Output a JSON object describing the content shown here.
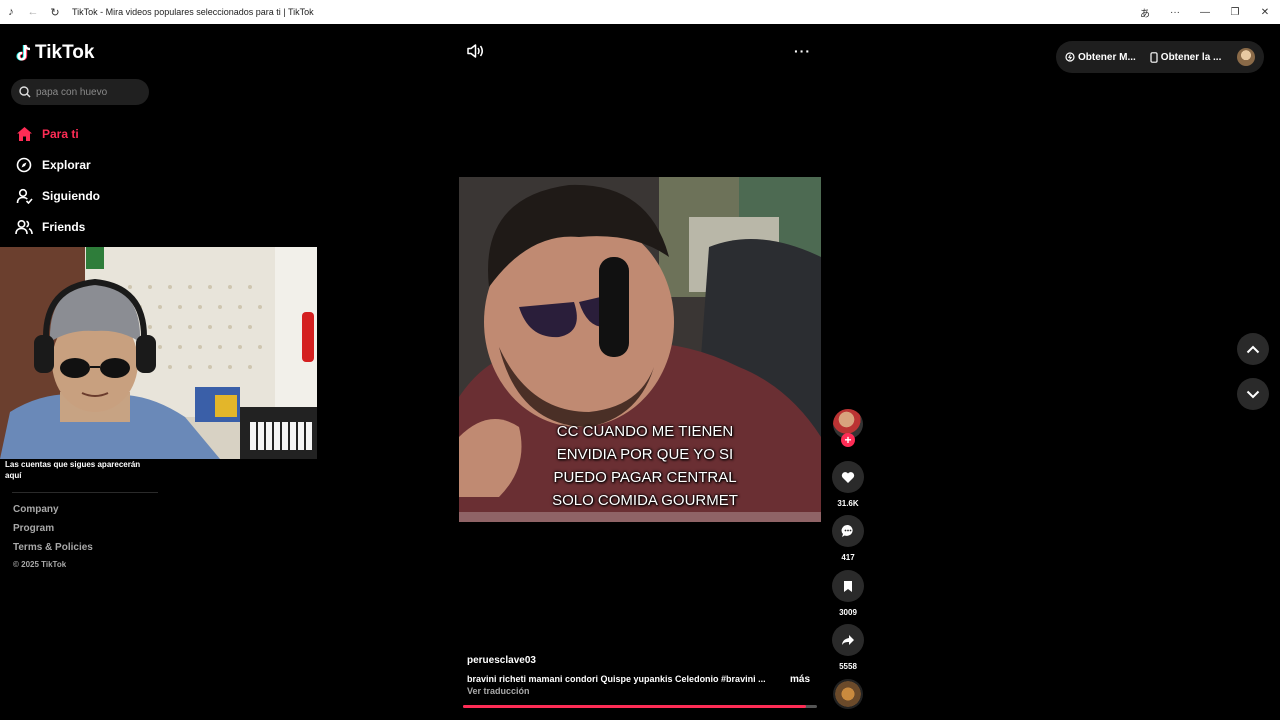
{
  "browser": {
    "title": "TikTok - Mira videos populares seleccionados para ti | TikTok"
  },
  "sidebar": {
    "logo": "TikTok",
    "search_placeholder": "papa con huevo",
    "nav": [
      {
        "label": "Para ti",
        "icon": "home-icon",
        "active": true
      },
      {
        "label": "Explorar",
        "icon": "compass-icon",
        "active": false
      },
      {
        "label": "Siguiendo",
        "icon": "user-follow-icon",
        "active": false
      },
      {
        "label": "Friends",
        "icon": "friends-icon",
        "active": false
      }
    ],
    "follow_hint": "Las cuentas que sigues aparecerán aquí",
    "footer": {
      "links": [
        "Company",
        "Program",
        "Terms & Policies"
      ],
      "copyright": "© 2025 TikTok"
    }
  },
  "top_actions": {
    "get_coins": "Obtener M...",
    "get_app": "Obtener la ..."
  },
  "video": {
    "caption_overlay": "CC CUANDO ME TIENEN\nENVIDIA POR QUE YO SI\nPUEDO PAGAR CENTRAL\nSOLO COMIDA GOURMET",
    "username": "peruesclave03",
    "description": "bravini richeti mamani condori Quispe yupankis Celedonio #bravini ...",
    "more": "más",
    "translate": "Ver traducción",
    "progress": 0.97
  },
  "actions": {
    "likes": "31.6K",
    "comments": "417",
    "saves": "3009",
    "shares": "5558"
  },
  "colors": {
    "accent": "#fe2c55",
    "background": "#000000",
    "button_bg": "#2a2a2a"
  }
}
